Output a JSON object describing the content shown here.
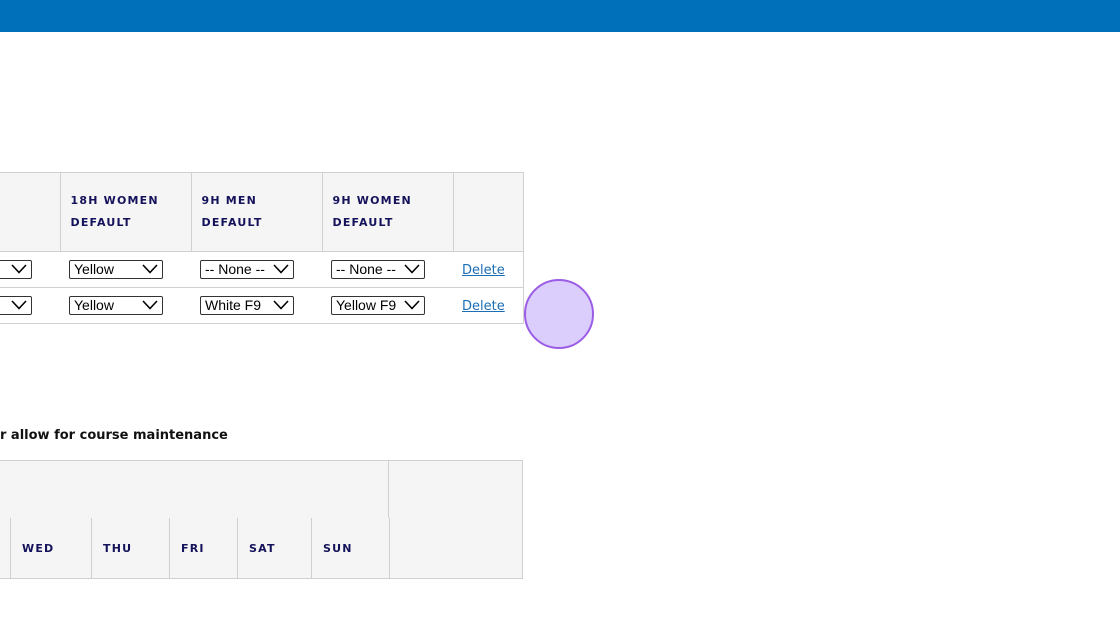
{
  "tees_table": {
    "headers": [
      {
        "line1": "",
        "line2": ""
      },
      {
        "line1": "18H WOMEN",
        "line2": "DEFAULT"
      },
      {
        "line1": "9H MEN",
        "line2": "DEFAULT"
      },
      {
        "line1": "9H WOMEN",
        "line2": "DEFAULT"
      },
      {
        "line1": "",
        "line2": ""
      }
    ],
    "rows": [
      {
        "col0": "",
        "col1": "Yellow",
        "col2": "-- None --",
        "col3": "-- None --",
        "action": "Delete"
      },
      {
        "col0": "",
        "col1": "Yellow",
        "col2": "White F9",
        "col3": "Yellow F9",
        "action": "Delete"
      }
    ]
  },
  "maintenance": {
    "label": "r allow for course maintenance",
    "days": [
      "WED",
      "THU",
      "FRI",
      "SAT",
      "SUN"
    ]
  },
  "colors": {
    "top_bar": "#0070ba",
    "header_text": "#14125a",
    "link": "#1b6db5",
    "click_indicator": "#9b5de5"
  },
  "icons": {
    "select_arrow": "chevron-down-icon"
  }
}
